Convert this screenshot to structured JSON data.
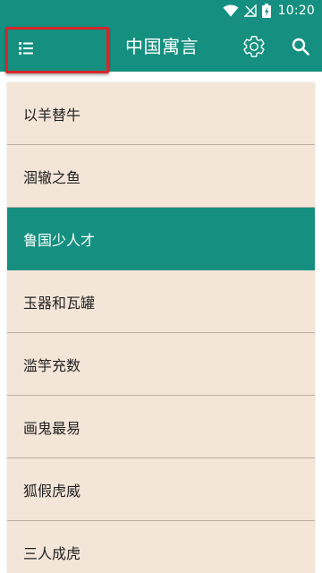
{
  "colors": {
    "primary": "#159080",
    "list_background": "#f3e6d8",
    "highlight_border": "#d7262b"
  },
  "status_bar": {
    "icons": [
      "wifi-icon",
      "signal-off-icon",
      "battery-charging-icon"
    ],
    "time": "10:20"
  },
  "app_bar": {
    "title": "中国寓言",
    "menu_icon": "list-menu-icon",
    "settings_icon": "gear-icon",
    "search_icon": "search-icon"
  },
  "list": {
    "selected_index": 2,
    "items": [
      {
        "label": "以羊替牛"
      },
      {
        "label": "涸辙之鱼"
      },
      {
        "label": "鲁国少人才"
      },
      {
        "label": "玉器和瓦罐"
      },
      {
        "label": "滥竽充数"
      },
      {
        "label": "画鬼最易"
      },
      {
        "label": "狐假虎威"
      },
      {
        "label": "三人成虎"
      }
    ]
  }
}
